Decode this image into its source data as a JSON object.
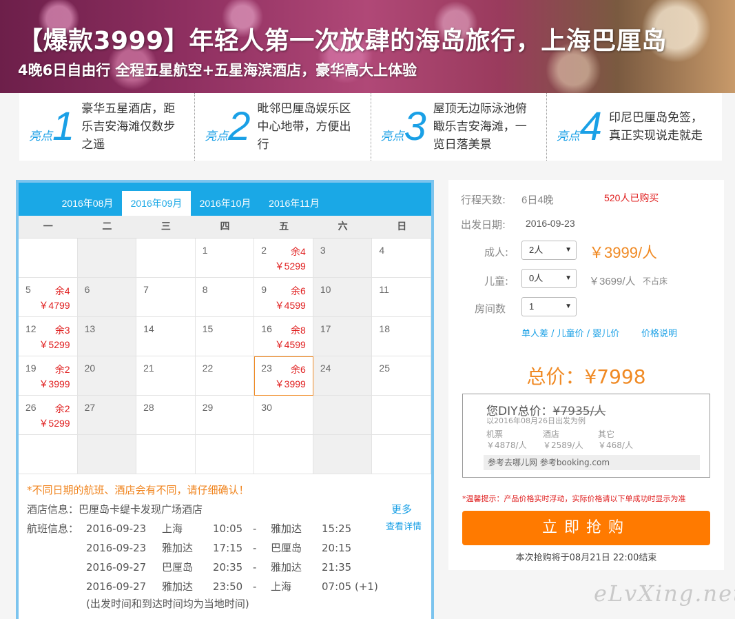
{
  "banner": {
    "title": "【爆款3999】年轻人第一次放肆的海岛旅行，上海巴厘岛",
    "subtitle": "4晚6日自由行 全程五星航空+五星海滨酒店，豪华高大上体验"
  },
  "highlights": [
    {
      "tag": "亮点",
      "num": "1",
      "text": "豪华五星酒店，距乐吉安海滩仅数步之遥"
    },
    {
      "tag": "亮点",
      "num": "2",
      "text": "毗邻巴厘岛娱乐区中心地带，方便出行"
    },
    {
      "tag": "亮点",
      "num": "3",
      "text": "屋顶无边际泳池俯瞰乐吉安海滩，一览日落美景"
    },
    {
      "tag": "亮点",
      "num": "4",
      "text": "印尼巴厘岛免签，真正实现说走就走"
    }
  ],
  "calendar": {
    "tabs": [
      "2016年08月",
      "2016年09月",
      "2016年10月",
      "2016年11月"
    ],
    "active_tab": 1,
    "weekdays": [
      "一",
      "二",
      "三",
      "四",
      "五",
      "六",
      "日"
    ],
    "rows": [
      [
        {
          "d": ""
        },
        {
          "d": ""
        },
        {
          "d": ""
        },
        {
          "d": "1"
        },
        {
          "d": "2",
          "rem": "余4",
          "price": "￥5299"
        },
        {
          "d": "3"
        },
        {
          "d": "4"
        }
      ],
      [
        {
          "d": "5",
          "rem": "余4",
          "price": "￥4799"
        },
        {
          "d": "6"
        },
        {
          "d": "7"
        },
        {
          "d": "8"
        },
        {
          "d": "9",
          "rem": "余6",
          "price": "￥4599"
        },
        {
          "d": "10"
        },
        {
          "d": "11"
        }
      ],
      [
        {
          "d": "12",
          "rem": "余3",
          "price": "￥5299"
        },
        {
          "d": "13"
        },
        {
          "d": "14"
        },
        {
          "d": "15"
        },
        {
          "d": "16",
          "rem": "余8",
          "price": "￥4599"
        },
        {
          "d": "17"
        },
        {
          "d": "18"
        }
      ],
      [
        {
          "d": "19",
          "rem": "余2",
          "price": "￥3999"
        },
        {
          "d": "20"
        },
        {
          "d": "21"
        },
        {
          "d": "22"
        },
        {
          "d": "23",
          "rem": "余6",
          "price": "￥3999",
          "selected": true
        },
        {
          "d": "24"
        },
        {
          "d": "25"
        }
      ],
      [
        {
          "d": "26",
          "rem": "余2",
          "price": "￥5299"
        },
        {
          "d": "27"
        },
        {
          "d": "28"
        },
        {
          "d": "29"
        },
        {
          "d": "30"
        },
        {
          "d": ""
        },
        {
          "d": ""
        }
      ],
      [
        {
          "d": ""
        },
        {
          "d": ""
        },
        {
          "d": ""
        },
        {
          "d": ""
        },
        {
          "d": ""
        },
        {
          "d": ""
        },
        {
          "d": ""
        }
      ]
    ],
    "weekend_cols": [
      1,
      5
    ],
    "warning": "*不同日期的航班、酒店会有不同，请仔细确认！",
    "hotel_info": "酒店信息：巴厘岛卡缇卡发现广场酒店",
    "more_label": "更多",
    "detail_label": "查看详情",
    "flight_label": "航班信息：",
    "flights": [
      [
        "2016-09-23",
        "上海",
        "10:05",
        "-",
        "雅加达",
        "15:25"
      ],
      [
        "2016-09-23",
        "雅加达",
        "17:15",
        "-",
        "巴厘岛",
        "20:15"
      ],
      [
        "2016-09-27",
        "巴厘岛",
        "20:35",
        "-",
        "雅加达",
        "21:35"
      ],
      [
        "2016-09-27",
        "雅加达",
        "23:50",
        "-",
        "上海",
        "07:05 (+1)"
      ]
    ],
    "flight_note": "(出发时间和到达时间均为当地时间)"
  },
  "booking": {
    "days_label": "行程天数:",
    "days_value": "6日4晚",
    "sold": "520人已购买",
    "date_label": "出发日期:",
    "date_value": "2016-09-23",
    "adult_label": "成人:",
    "adult_value": "2人",
    "adult_price": "￥3999/人",
    "child_label": "儿童:",
    "child_value": "0人",
    "child_price": "￥3699/人",
    "child_note": "不占床",
    "room_label": "房间数",
    "room_value": "1",
    "links_label": "单人差 / 儿童价 / 婴儿价",
    "price_note_label": "价格说明",
    "total": "总价：¥7998",
    "diy_label": "您DIY总价：",
    "diy_old": "¥7935/人",
    "diy_sub": "以2016年08月26日出发为例",
    "diy_cols": [
      {
        "name": "机票",
        "value": "￥4878/人"
      },
      {
        "name": "酒店",
        "value": "￥2589/人"
      },
      {
        "name": "其它",
        "value": "￥468/人"
      }
    ],
    "diy_ref": "参考去哪儿网    参考booking.com",
    "tip": "*温馨提示：产品价格实时浮动，实际价格请以下单成功时显示为准",
    "buy_label": "立即抢购",
    "end_text": "本次抢购将于08月21日 22:00结束"
  },
  "watermark": "eLvXing.net",
  "colors": {
    "accent": "#1aa8e6",
    "price": "#e02020",
    "buy": "#ff7a00",
    "total": "#f08a24"
  }
}
